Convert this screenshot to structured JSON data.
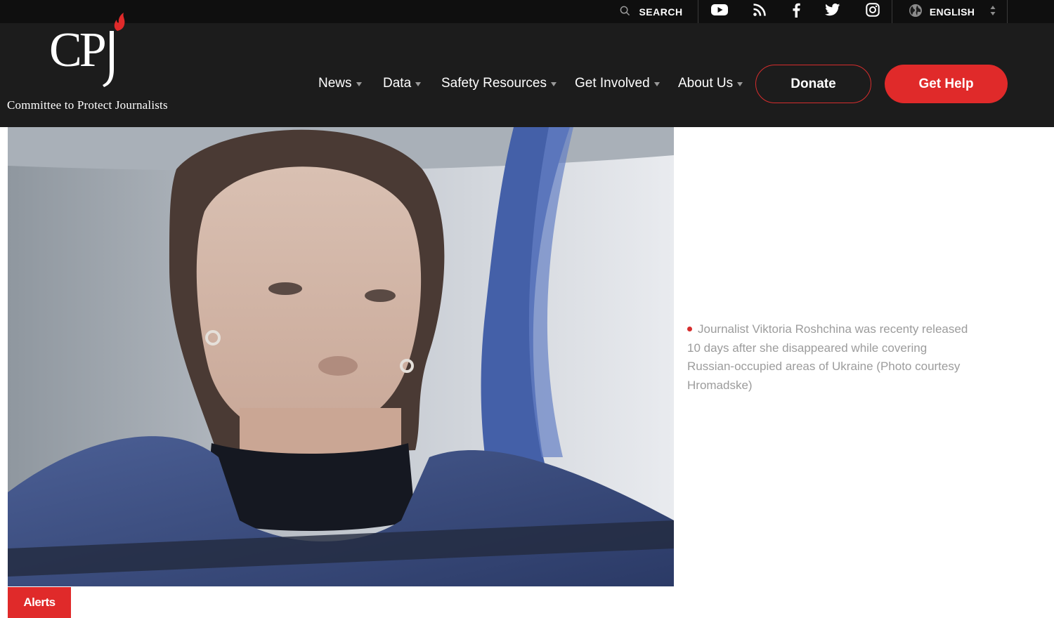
{
  "topbar": {
    "search_label": "SEARCH",
    "social_icons": [
      "youtube-icon",
      "rss-icon",
      "facebook-icon",
      "twitter-icon",
      "instagram-icon"
    ],
    "language_label": "ENGLISH"
  },
  "logo": {
    "mark": "CPJ",
    "tagline": "Committee to Protect Journalists"
  },
  "nav": {
    "items": [
      {
        "label": "News"
      },
      {
        "label": "Data"
      },
      {
        "label": "Safety Resources"
      },
      {
        "label": "Get Involved"
      },
      {
        "label": "About Us"
      }
    ],
    "donate_label": "Donate",
    "help_label": "Get Help"
  },
  "hero": {
    "caption": "Journalist Viktoria Roshchina was recenty released 10 days after she disappeared while covering Russian-occupied areas of Ukraine (Photo courtesy Hromadske)"
  },
  "tag": {
    "label": "Alerts"
  },
  "colors": {
    "header_bg": "#1c1c1c",
    "topbar_bg": "#0f0f0f",
    "accent_red": "#e02a2a",
    "caption_text": "#9c9c9c"
  }
}
